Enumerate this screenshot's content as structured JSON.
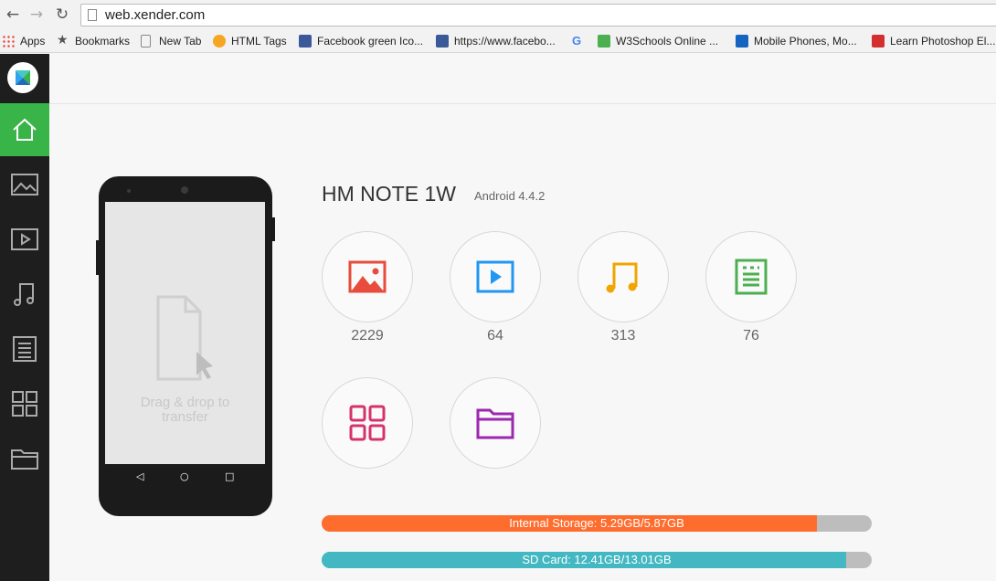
{
  "browser": {
    "url": "web.xender.com",
    "bookmarks": [
      {
        "label": "Apps",
        "color": "#e74c3c"
      },
      {
        "label": "Bookmarks",
        "color": "#555555"
      },
      {
        "label": "New Tab",
        "color": "#ffffff"
      },
      {
        "label": "HTML Tags",
        "color": "#f5a623"
      },
      {
        "label": "Facebook green Ico...",
        "color": "#3b5998"
      },
      {
        "label": "https://www.facebo...",
        "color": "#3b5998"
      },
      {
        "label": "",
        "color": "#4285f4"
      },
      {
        "label": "W3Schools Online ...",
        "color": "#4caf50"
      },
      {
        "label": "Mobile Phones, Mo...",
        "color": "#1565c0"
      },
      {
        "label": "Learn Photoshop El...",
        "color": "#d32f2f"
      }
    ]
  },
  "sidebar": {
    "items": [
      "home-icon",
      "photos-icon",
      "videos-icon",
      "music-icon",
      "documents-icon",
      "apps-icon",
      "folder-icon"
    ],
    "active": "home-icon",
    "active_color": "#38b449"
  },
  "device": {
    "name": "HM NOTE 1W",
    "os": "Android 4.4.2",
    "drop_hint": "Drag & drop to transfer"
  },
  "categories": [
    {
      "icon": "photos-icon",
      "count": "2229",
      "color": "#e74c3c"
    },
    {
      "icon": "videos-icon",
      "count": "64",
      "color": "#2196f3"
    },
    {
      "icon": "music-icon",
      "count": "313",
      "color": "#f0a500"
    },
    {
      "icon": "documents-icon",
      "count": "76",
      "color": "#4caf50"
    },
    {
      "icon": "apps-icon",
      "count": "",
      "color": "#d6336c"
    },
    {
      "icon": "folder-icon",
      "count": "",
      "color": "#9c27b0"
    }
  ],
  "storage": [
    {
      "label": "Internal Storage: 5.29GB/5.87GB",
      "fraction": 0.901,
      "color": "#ff6d2e"
    },
    {
      "label": "SD Card: 12.41GB/13.01GB",
      "fraction": 0.954,
      "color": "#43b8c2"
    }
  ]
}
